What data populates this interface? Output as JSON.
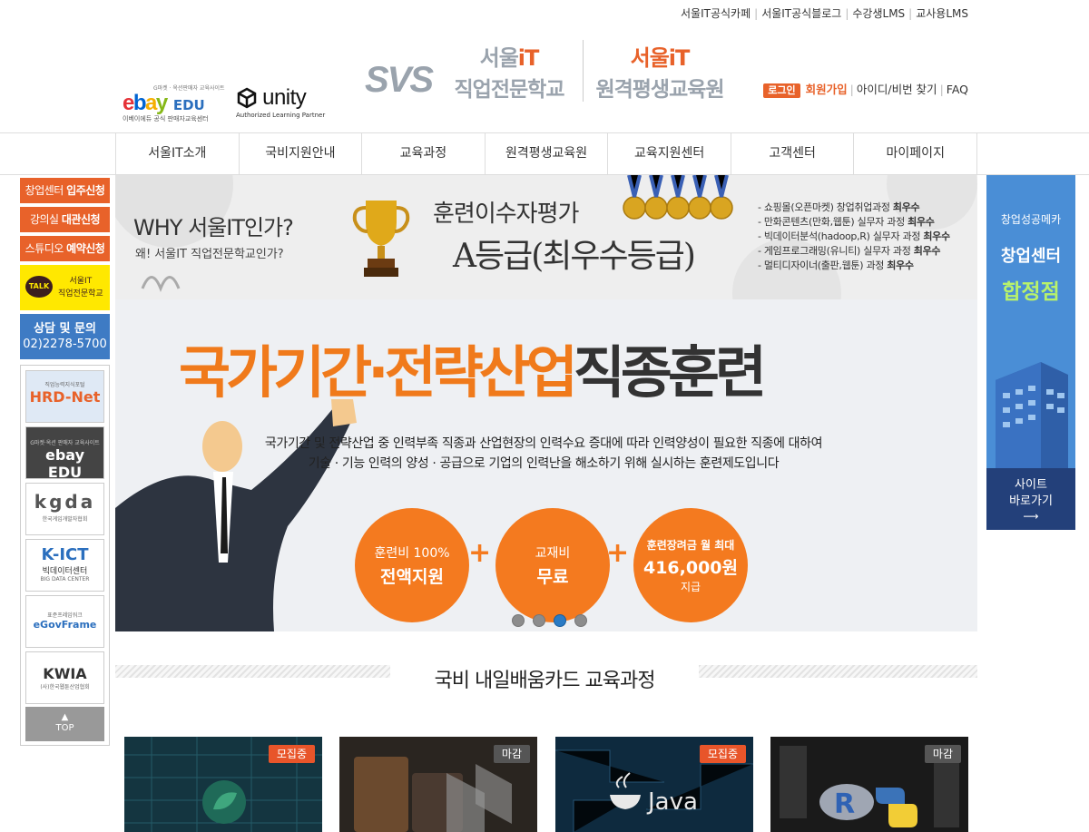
{
  "top_links": [
    "서울IT공식카페",
    "서울IT공식블로그",
    "수강생LMS",
    "교사용LMS"
  ],
  "header": {
    "ebay": {
      "tiny": "G마켓 · 옥션판매자 교육사이트",
      "word": "ebay",
      "edu": "EDU",
      "sub": "이베이에듀 공식 판매자교육센터"
    },
    "unity": {
      "name": "unity",
      "sub": "Authorized Learning Partner"
    },
    "logo": {
      "svs": "SVS",
      "seoul_a": "서울",
      "it_a": "iT",
      "school": "직업전문학교",
      "seoul_b": "서울",
      "it_b": "iT",
      "institute": "원격평생교육원"
    }
  },
  "login_bar": {
    "login": "로그인",
    "join": "회원가입",
    "find": "아이디/비번 찾기",
    "faq": "FAQ"
  },
  "gnb": [
    "서울IT소개",
    "국비지원안내",
    "교육과정",
    "원격평생교육원",
    "교육지원센터",
    "고객센터",
    "마이페이지"
  ],
  "quick_menu": [
    {
      "label": "창업센터",
      "strong": "입주신청"
    },
    {
      "label": "강의실",
      "strong": "대관신청"
    },
    {
      "label": "스튜디오",
      "strong": "예약신청"
    }
  ],
  "talk": {
    "bubble": "TALK",
    "line1": "서울IT",
    "line2": "직업전문학교"
  },
  "consult": {
    "title": "상담 및 문의",
    "phone": "02)2278-5700"
  },
  "partners": [
    {
      "sub": "직업능력지식포털",
      "name": "HRD-Net"
    },
    {
      "sub": "G마켓·옥션 판매자 교육사이트",
      "name": "ebay EDU"
    },
    {
      "sub": "한국게임개발자협회",
      "name": "kgda"
    },
    {
      "sub": "BIG DATA CENTER",
      "name": "K-ICT",
      "name2": "빅데이터센터"
    },
    {
      "sub": "표준프레임워크",
      "name": "eGovFrame"
    },
    {
      "sub": "(사)한국웹툰산업협회",
      "name": "KWIA"
    }
  ],
  "top_button": "TOP",
  "banner": {
    "why": "WHY 서울IT인가?",
    "why_sub": "왜! 서울IT 직업전문학교인가?",
    "eval": "훈련이수자평가",
    "grade": "A등급(최우수등급)",
    "list": [
      {
        "text": "- 쇼핑몰(오픈마켓) 창업취업과정",
        "strong": "최우수"
      },
      {
        "text": "- 만화콘텐츠(만화,웹툰) 실무자 과정",
        "strong": "최우수"
      },
      {
        "text": "- 빅데이터분석(hadoop,R) 실무자 과정",
        "strong": "최우수"
      },
      {
        "text": "- 게임프로그래밍(유니티) 실무자 과정",
        "strong": "최우수"
      },
      {
        "text": "- 멀티디자이너(출판,웹툰) 과정",
        "strong": "최우수"
      }
    ]
  },
  "hero": {
    "headline_orange": "국가기간·전략산업",
    "headline_dark": "직종훈련",
    "desc1": "국가기간 및 전략산업 중 인력부족 직종과 산업현장의 인력수요 증대에 따라 인력양성이 필요한 직종에 대하여",
    "desc2": "기술 · 기능 인력의 양성 · 공급으로 기업의 인력난을 해소하기 위해 실시하는 훈련제도입니다",
    "circles": [
      {
        "l1": "훈련비 100%",
        "l2": "전액지원"
      },
      {
        "l1": "교재비",
        "l2": "무료"
      },
      {
        "l1": "훈련장려금 월 최대",
        "l2": "416,000원",
        "l3": "지급"
      }
    ],
    "slides": 4,
    "active_slide": 3
  },
  "right_banner": {
    "t1": "창업성공메카",
    "t2": "창업센터",
    "t3": "합정점",
    "go1": "사이트",
    "go2": "바로가기"
  },
  "section_title": "국비 내일배움카드 교육과정",
  "courses": [
    {
      "badge": "모집중",
      "status": "open"
    },
    {
      "badge": "마감",
      "status": "closed"
    },
    {
      "badge": "모집중",
      "status": "open"
    },
    {
      "badge": "마감",
      "status": "closed"
    }
  ],
  "colors": {
    "accent": "#e8622a",
    "blue": "#3e7bc4",
    "orange_circle": "#f47a1f"
  }
}
